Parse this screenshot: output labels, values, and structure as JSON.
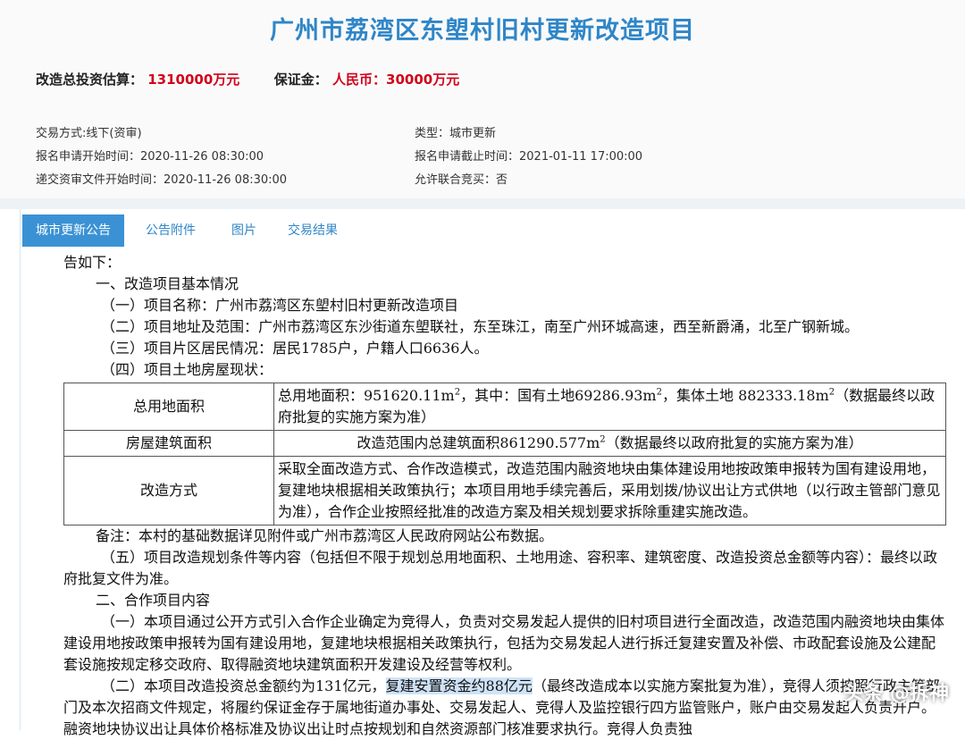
{
  "header": {
    "title": "广州市荔湾区东塱村旧村更新改造项目",
    "investment_label": "改造总投资估算：",
    "investment_value": "1310000万元",
    "deposit_label": "保证金：",
    "deposit_value": "人民币：30000万元",
    "info": [
      "交易方式:线下(资审)",
      "类型：城市更新",
      "报名申请开始时间：2020-11-26 08:30:00",
      "报名申请截止时间：2021-01-11 17:00:00",
      "递交资审文件开始时间：2020-11-26 08:30:00",
      "允许联合竞买：否"
    ]
  },
  "tabs": [
    "城市更新公告",
    "公告附件",
    "图片",
    "交易结果"
  ],
  "doc": {
    "l01": "告如下：",
    "l02": "一、改造项目基本情况",
    "l03": "（一）项目名称：广州市荔湾区东塱村旧村更新改造项目",
    "l04": "（二）项目地址及范围：广州市荔湾区东沙街道东塱联社，东至珠江，南至广州环城高速，西至新爵涌，北至广钢新城。",
    "l05": "（三）项目片区居民情况：居民1785户，户籍人口6636人。",
    "l06": "（四）项目土地房屋现状：",
    "table": {
      "r1k": "总用地面积",
      "r1a": "总用地面积：951620.11m",
      "r1b": "，其中：国有土地69286.93m",
      "r1c": "，集体土地 882333.18m",
      "r1d": "（数据最终以政府批复的实施方案为准）",
      "r2k": "房屋建筑面积",
      "r2a": "改造范围内总建筑面积861290.577m",
      "r2b": "（数据最终以政府批复的实施方案为准）",
      "r3k": "改造方式",
      "r3v": "采取全面改造方式、合作改造模式，改造范围内融资地块由集体建设用地按政策申报转为国有建设用地，复建地块根据相关政策执行；本项目用地手续完善后，采用划拨/协议出让方式供地（以行政主管部门意见为准），合作企业按照经批准的改造方案及相关规划要求拆除重建实施改造。",
      "sup": "2"
    },
    "l07": "备注：本村的基础数据详见附件或广州市荔湾区人民政府网站公布数据。",
    "l08": "（五）项目改造规划条件等内容（包括但不限于规划总用地面积、土地用途、容积率、建筑密度、改造投资总金额等内容）：最终以政府批复文件为准。",
    "l09": "二、合作项目内容",
    "l10": "（一）本项目通过公开方式引入合作企业确定为竞得人，负责对交易发起人提供的旧村项目进行全面改造，改造范围内融资地块由集体建设用地按政策申报转为国有建设用地，复建地块根据相关政策执行，包括为交易发起人进行拆迁复建安置及补偿、市政配套设施及公建配套设施按规定移交政府、取得融资地块建筑面积开发建设及经营等权利。",
    "l11a": "（二）本项目改造投资总金额约为131亿元，",
    "l11b": "复建安置资金约88亿元",
    "l11c": "（最终改造成本以实施方案批复为准），竞得人须按照行政主管部门及本次招商文件规定，将履约保证金存于属地街道办事处、交易发起人、竞得人及监控银行四方监管账户，账户由交易发起人负责开户。融资地块协议出让具体价格标准及协议出让时点按规划和自然资源部门核准要求执行。竞得人负责独"
  },
  "watermark": "头条 @拆神"
}
